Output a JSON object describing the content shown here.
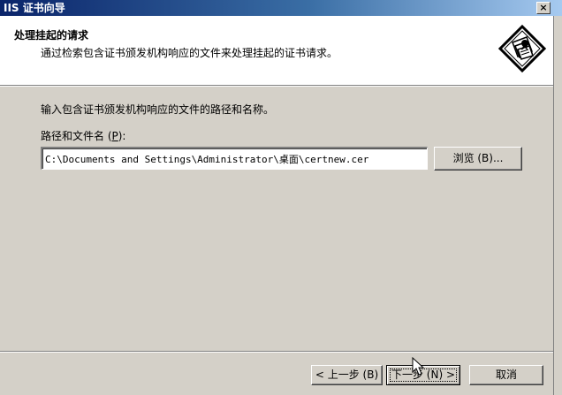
{
  "window": {
    "title": "IIS 证书向导",
    "close_label": "×"
  },
  "header": {
    "title": "处理挂起的请求",
    "subtitle": "通过检索包含证书颁发机构响应的文件来处理挂起的证书请求。",
    "icon": "certificate-wizard-icon"
  },
  "body": {
    "instruction": "输入包含证书颁发机构响应的文件的路径和名称。",
    "path_label_prefix": "路径和文件名 (",
    "path_label_key": "P",
    "path_label_suffix": "):",
    "path_value": "C:\\Documents and Settings\\Administrator\\桌面\\certnew.cer",
    "browse_label": "浏览 (B)..."
  },
  "footer": {
    "back_label": "< 上一步 (B)",
    "next_label": "下一步 (N) >",
    "cancel_label": "取消"
  },
  "colors": {
    "title_bar_start": "#0a246a",
    "title_bar_end": "#a6caf0",
    "dialog_face": "#d4d0c8",
    "header_bg": "#ffffff"
  }
}
